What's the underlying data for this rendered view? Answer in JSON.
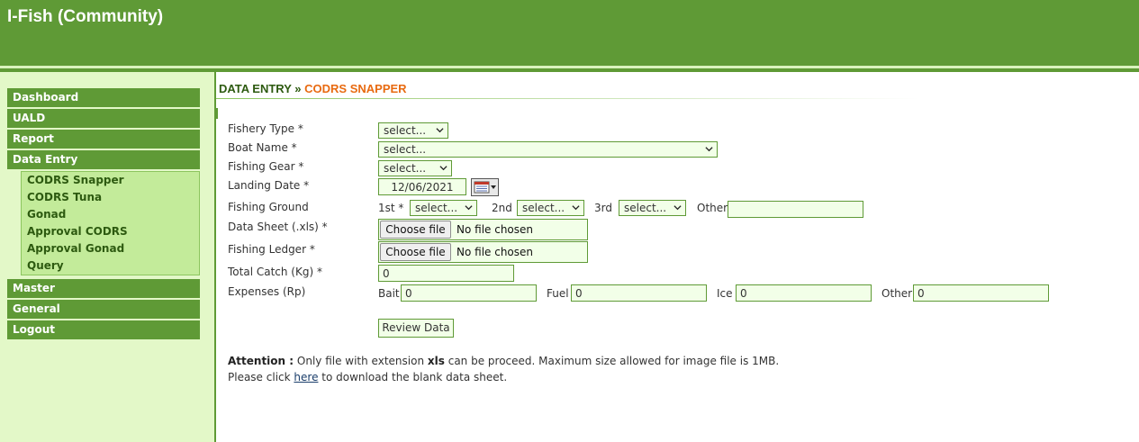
{
  "app": {
    "title": "I-Fish (Community)"
  },
  "sidebar": {
    "items": [
      {
        "label": "Dashboard"
      },
      {
        "label": "UALD"
      },
      {
        "label": "Report"
      },
      {
        "label": "Data Entry"
      },
      {
        "label": "Master"
      },
      {
        "label": "General"
      },
      {
        "label": "Logout"
      }
    ],
    "submenu": [
      {
        "label": "CODRS Snapper"
      },
      {
        "label": "CODRS Tuna"
      },
      {
        "label": "Gonad"
      },
      {
        "label": "Approval CODRS"
      },
      {
        "label": "Approval Gonad"
      },
      {
        "label": "Query"
      }
    ]
  },
  "breadcrumb": {
    "section": "DATA ENTRY",
    "separator": "»",
    "page": "CODRS SNAPPER"
  },
  "form": {
    "fishery_type": {
      "label": "Fishery Type *",
      "value": "select..."
    },
    "boat_name": {
      "label": "Boat Name *",
      "value": "select..."
    },
    "fishing_gear": {
      "label": "Fishing Gear *",
      "value": "select..."
    },
    "landing_date": {
      "label": "Landing Date *",
      "value": "12/06/2021"
    },
    "fishing_ground": {
      "label": "Fishing Ground",
      "first_label": "1st *",
      "first_value": "select...",
      "second_label": "2nd",
      "second_value": "select...",
      "third_label": "3rd",
      "third_value": "select...",
      "other_label": "Other",
      "other_value": ""
    },
    "data_sheet": {
      "label": "Data Sheet (.xls) *",
      "button": "Choose file",
      "status": "No file chosen"
    },
    "fishing_ledger": {
      "label": "Fishing Ledger *",
      "button": "Choose file",
      "status": "No file chosen"
    },
    "total_catch": {
      "label": "Total Catch (Kg) *",
      "value": "0"
    },
    "expenses": {
      "label": "Expenses (Rp)",
      "bait_label": "Bait",
      "bait_value": "0",
      "fuel_label": "Fuel",
      "fuel_value": "0",
      "ice_label": "Ice",
      "ice_value": "0",
      "other_label": "Other",
      "other_value": "0"
    },
    "review_button": "Review Data"
  },
  "notes": {
    "attention_label": "Attention :",
    "line1_before": "Only file with extension",
    "line1_ext": "xls",
    "line1_after": "can be proceed. Maximum size allowed for image file is 1MB.",
    "line2_before": "Please click",
    "line2_link": "here",
    "line2_after": "to download the blank data sheet."
  },
  "colors": {
    "brand_green": "#5f9a36",
    "sidebar_bg": "#e3f8c8",
    "submenu_bg": "#c3eb9a",
    "accent_orange": "#e86a10",
    "field_bg": "#f2ffe8"
  },
  "icons": {
    "dropdown": "chevron-down-icon",
    "calendar": "calendar-icon"
  }
}
